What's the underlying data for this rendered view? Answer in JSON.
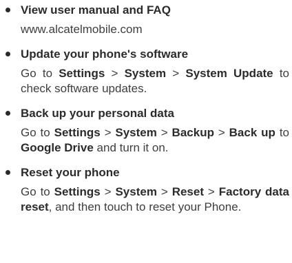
{
  "items": [
    {
      "title": "View user manual and FAQ",
      "body": {
        "url": "www.alcatelmobile.com"
      }
    },
    {
      "title": "Update your phone's software",
      "body": {
        "go_to": "Go to ",
        "settings": "Settings",
        "sep1": " > ",
        "system": "System",
        "sep2": " > ",
        "target": "System Update",
        "tail": " to check software updates."
      }
    },
    {
      "title": "Back up your personal data",
      "body": {
        "go_to": "Go to ",
        "settings": "Settings",
        "sep1": " > ",
        "system": "System",
        "sep2": " > ",
        "backup": "Backup",
        "sep3": " > ",
        "backup_up": "Back up",
        "to": " to ",
        "drive": "Google Drive",
        "tail": " and turn it on."
      }
    },
    {
      "title": "Reset your phone",
      "body": {
        "go_to": "Go to ",
        "settings": "Settings",
        "sep1": " > ",
        "system": "System",
        "sep2": " > ",
        "reset": "Reset",
        "sep3": " > ",
        "factory": "Factory data reset",
        "tail": ", and then touch to reset your Phone."
      }
    }
  ]
}
